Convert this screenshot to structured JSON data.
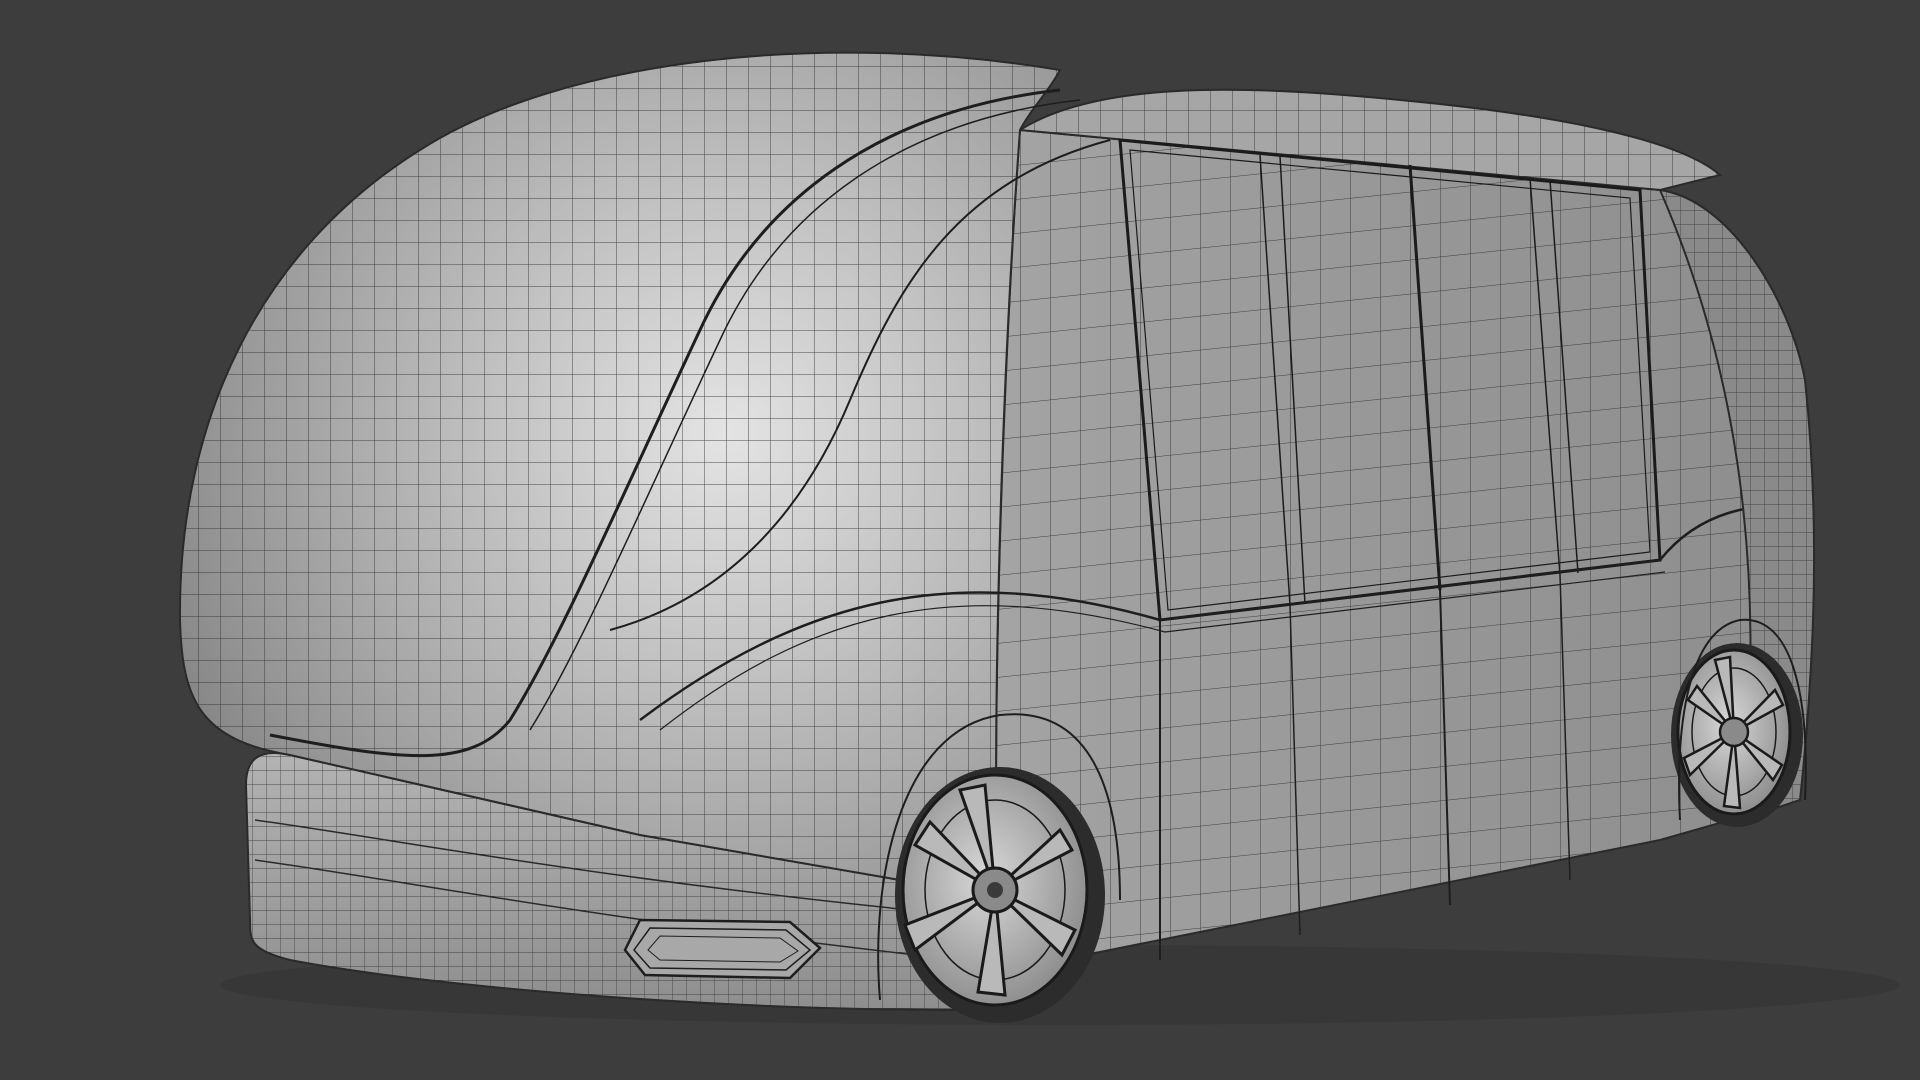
{
  "viewport": {
    "background": "#3d3d3d",
    "shading": "solid",
    "overlay": "wireframe"
  },
  "model": {
    "subject": "autonomous-shuttle-pod",
    "body_color": "#9a9a9a",
    "highlight_color": "#dedede",
    "shadow_color": "#6a6a6a",
    "wire_color": "#2a2a2a",
    "wheel_count_visible": 2
  }
}
